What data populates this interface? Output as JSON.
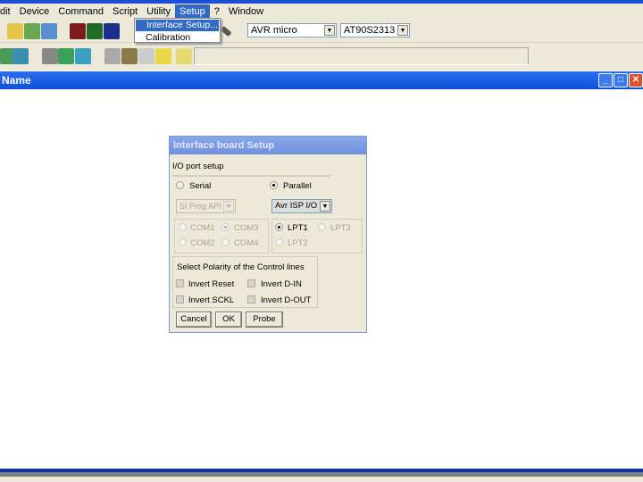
{
  "menubar": [
    "dit",
    "Device",
    "Command",
    "Script",
    "Utility",
    "Setup",
    "?",
    "Window"
  ],
  "setup_menu": {
    "items": [
      "Interface Setup...",
      "Calibration"
    ]
  },
  "toolbar": {
    "device_family": "AVR micro",
    "device": "AT90S2313"
  },
  "child_window": {
    "title": "Name"
  },
  "dialog": {
    "title": "Interface board Setup",
    "section_label": "I/O port setup",
    "serial_label": "Serial",
    "parallel_label": "Parallel",
    "serial_combo": "SI Prog API",
    "parallel_combo": "Avr ISP I/O",
    "com_ports": [
      "COM1",
      "COM3",
      "COM2",
      "COM4"
    ],
    "lpt_ports": [
      "LPT1",
      "LPT3",
      "LPT2"
    ],
    "polarity_label": "Select Polarity of the Control lines",
    "checkboxes": [
      "Invert Reset",
      "Invert D-IN",
      "Invert SCKL",
      "Invert D-OUT"
    ],
    "buttons": {
      "cancel": "Cancel",
      "ok": "OK",
      "probe": "Probe"
    }
  }
}
